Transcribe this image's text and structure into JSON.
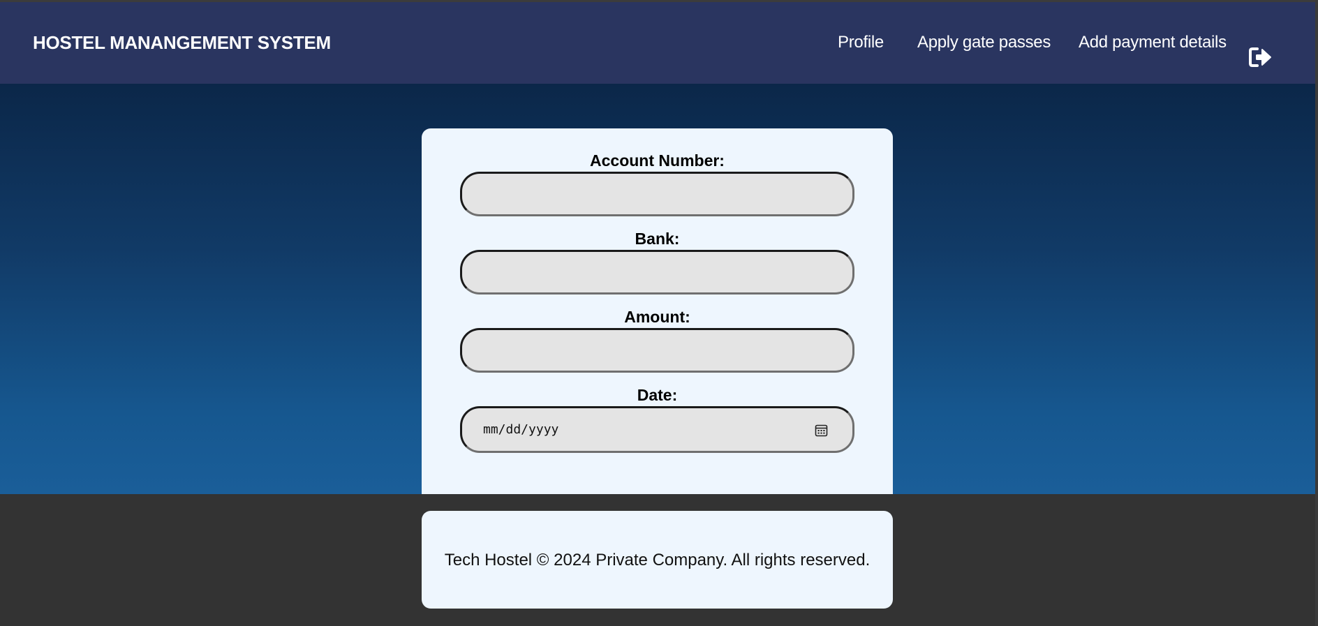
{
  "header": {
    "brand": "HOSTEL MANANGEMENT SYSTEM",
    "nav": [
      {
        "label": "Profile"
      },
      {
        "label": "Apply gate passes"
      },
      {
        "label": "Add payment details"
      }
    ],
    "logout_icon": "sign-out-icon"
  },
  "form": {
    "fields": [
      {
        "label": "Account Number:",
        "value": ""
      },
      {
        "label": "Bank:",
        "value": ""
      },
      {
        "label": "Amount:",
        "value": ""
      },
      {
        "label": "Date:",
        "placeholder": "mm/dd/yyyy"
      }
    ],
    "calendar_icon": "calendar-icon"
  },
  "footer": {
    "text": "Tech Hostel © 2024 Private Company. All rights reserved."
  },
  "colors": {
    "navbar": "#2a3560",
    "hero_top": "#0b2749",
    "hero_bottom": "#1a5e99",
    "card": "#eef6fe",
    "footer_bg": "#333333",
    "input_bg": "#e4e4e4"
  }
}
